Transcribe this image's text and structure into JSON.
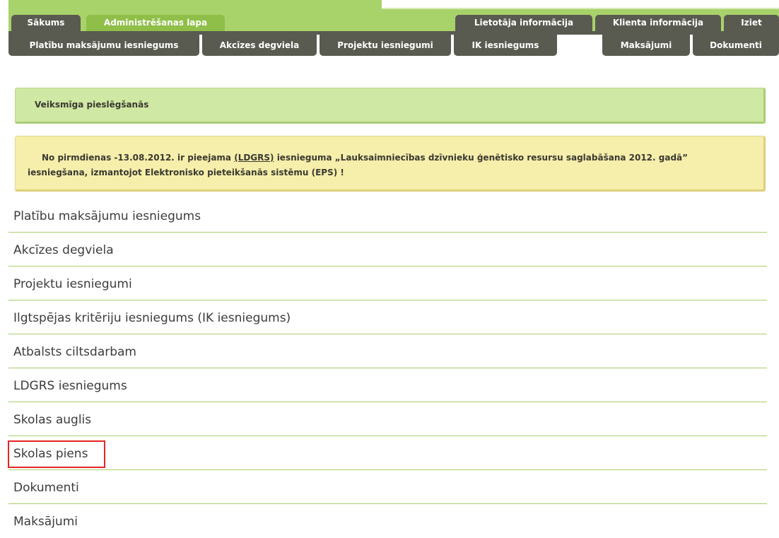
{
  "top_tabs": {
    "home": "Sākums",
    "admin": "Administrēšanas lapa",
    "user_info": "Lietotāja informācija",
    "client_info": "Klienta informācija",
    "logout": "Iziet"
  },
  "sub_tabs": {
    "area_payments": "Platību maksājumu iesniegums",
    "excise_fuel": "Akcīzes degviela",
    "project_apps": "Projektu iesniegumi",
    "ik_apps": "IK iesniegums",
    "payments": "Maksājumi",
    "documents": "Dokumenti"
  },
  "messages": {
    "success": "Veiksmīga pieslēgšanās",
    "notice_before": "No pirmdienas -13.08.2012. ir pieejama ",
    "notice_link": "(LDGRS)",
    "notice_after": " iesnieguma „Lauksaimniecības dzīvnieku ģenētisko resursu saglabāšana 2012. gadā” iesniegšana, izmantojot Elektronisko pieteikšanās sistēmu (EPS) !"
  },
  "links": [
    "Platību maksājumu iesniegums",
    "Akcīzes degviela",
    "Projektu iesniegumi",
    "Ilgtspējas kritēriju iesniegums (IK iesniegums)",
    "Atbalsts ciltsdarbam",
    "LDGRS iesniegums",
    "Skolas auglis",
    "Skolas piens",
    "Dokumenti",
    "Maksājumi"
  ],
  "colors": {
    "accent_green": "#a8d26a",
    "dark_tab": "#595a50",
    "highlight_red": "#e32626"
  }
}
